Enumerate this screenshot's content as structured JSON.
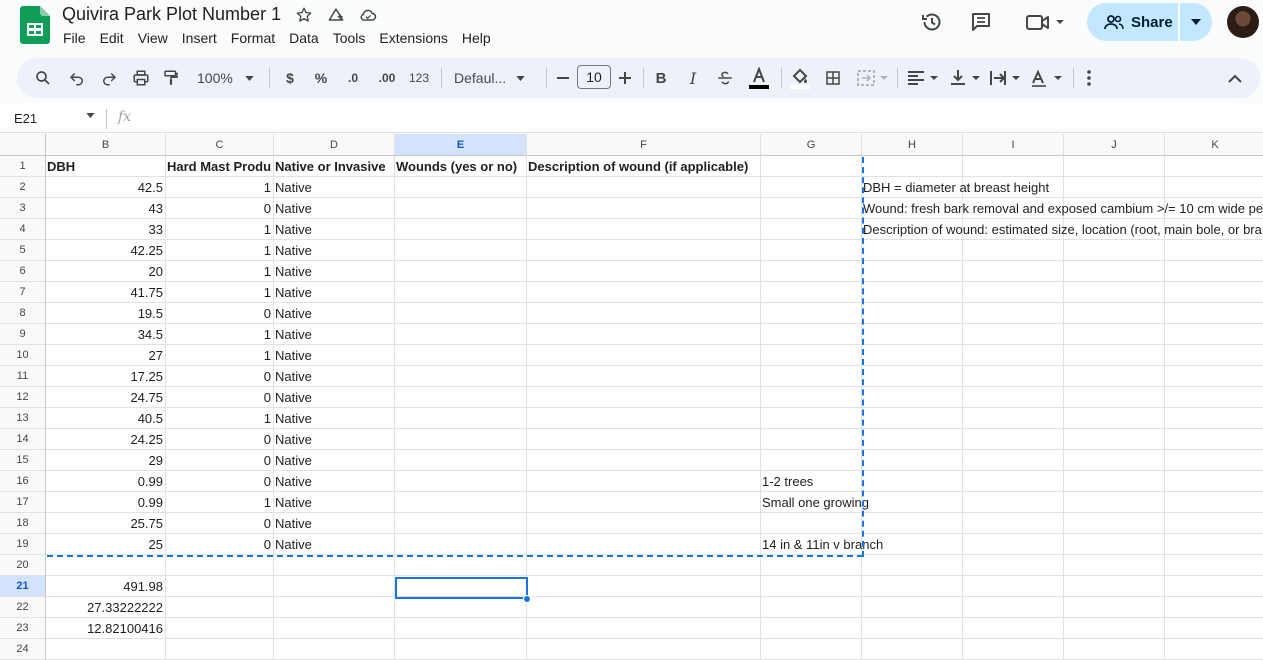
{
  "document": {
    "title": "Quivira Park Plot Number 1"
  },
  "menu": [
    "File",
    "Edit",
    "View",
    "Insert",
    "Format",
    "Data",
    "Tools",
    "Extensions",
    "Help"
  ],
  "share": {
    "label": "Share"
  },
  "toolbar": {
    "zoom": "100%",
    "currency": "$",
    "percent": "%",
    "decrease_decimals": ".0",
    "increase_decimals": ".00",
    "number_format": "123",
    "font": "Defaul...",
    "font_size": "10"
  },
  "formula_bar": {
    "cell_ref": "E21",
    "fx": "fx",
    "value": ""
  },
  "grid": {
    "columns": [
      "B",
      "C",
      "D",
      "E",
      "F",
      "G",
      "H",
      "I",
      "J",
      "K"
    ],
    "selected_column": "E",
    "rows": [
      "1",
      "2",
      "3",
      "4",
      "5",
      "6",
      "7",
      "8",
      "9",
      "10",
      "11",
      "12",
      "13",
      "14",
      "15",
      "16",
      "17",
      "18",
      "19",
      "20",
      "21",
      "22",
      "23",
      "24"
    ],
    "selected_row": "21",
    "headers": {
      "B": "DBH",
      "C": "Hard Mast Produ",
      "D": "Native or Invasive",
      "E": "Wounds (yes or no)",
      "F": "Description of wound (if applicable)"
    },
    "dbh": [
      "42.5",
      "43",
      "33",
      "42.25",
      "20",
      "41.75",
      "19.5",
      "34.5",
      "27",
      "17.25",
      "24.75",
      "40.5",
      "24.25",
      "29",
      "0.99",
      "0.99",
      "25.75",
      "25"
    ],
    "hard_mast": [
      "1",
      "0",
      "1",
      "1",
      "1",
      "1",
      "0",
      "1",
      "1",
      "0",
      "0",
      "1",
      "0",
      "0",
      "0",
      "1",
      "0",
      "0"
    ],
    "native": [
      "Native",
      "Native",
      "Native",
      "Native",
      "Native",
      "Native",
      "Native",
      "Native",
      "Native",
      "Native",
      "Native",
      "Native",
      "Native",
      "Native",
      "Native",
      "Native",
      "Native",
      "Native"
    ],
    "notes_g": {
      "16": "1-2 trees",
      "17": "Small one growing",
      "19": "14 in & 11in v branch"
    },
    "notes_h": {
      "2": "DBH = diameter at breast height",
      "3": "Wound: fresh bark removal and exposed cambium >/= 10 cm wide per",
      "4": "Description of wound: estimated size, location (root, main bole, or bra"
    },
    "summary": {
      "21": "491.98",
      "22": "27.33222222",
      "23": "12.82100416"
    }
  },
  "colors": {
    "accent": "#1a73e8",
    "share_bg": "#c2e7ff",
    "sheets_green": "#0f9d58"
  }
}
